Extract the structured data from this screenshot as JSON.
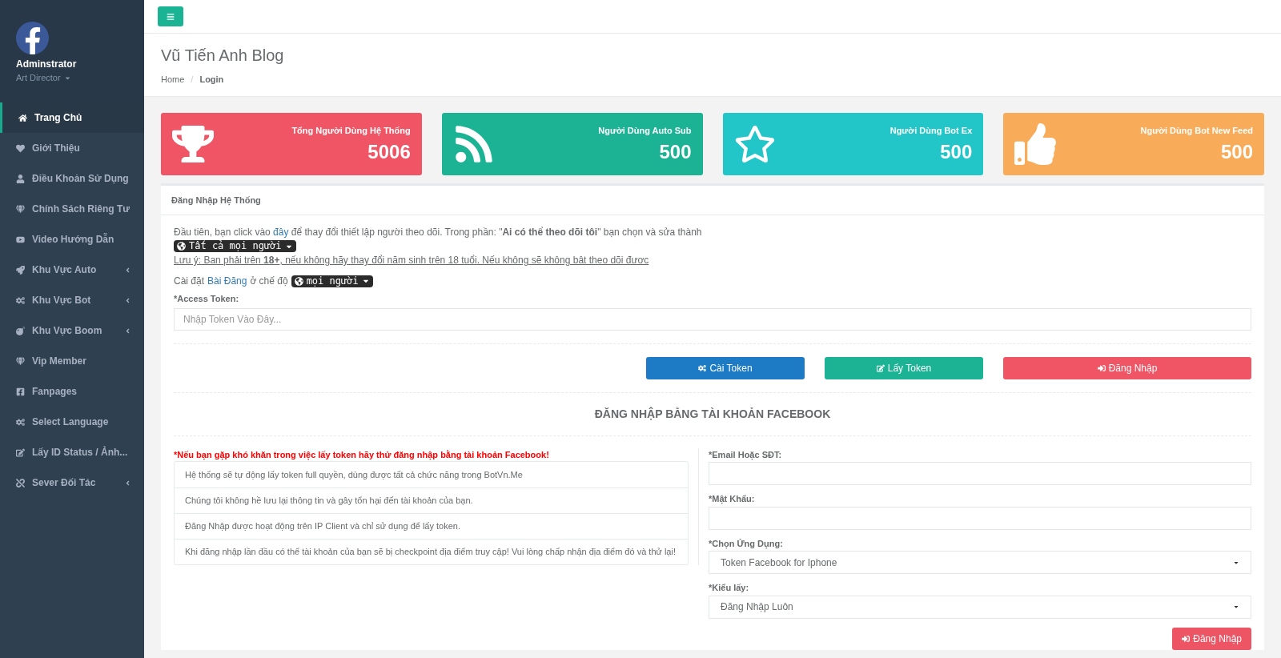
{
  "profile": {
    "name": "Adminstrator",
    "role": "Art Director"
  },
  "sidebar": {
    "items": [
      {
        "label": "Trang Chủ",
        "selected": true,
        "has_submenu": false
      },
      {
        "label": "Giới Thiệu",
        "selected": false,
        "has_submenu": false
      },
      {
        "label": "Điều Khoản Sử Dụng",
        "selected": false,
        "has_submenu": false
      },
      {
        "label": "Chính Sách Riêng Tư",
        "selected": false,
        "has_submenu": false
      },
      {
        "label": "Video Hướng Dẫn",
        "selected": false,
        "has_submenu": false
      },
      {
        "label": "Khu Vực Auto",
        "selected": false,
        "has_submenu": true
      },
      {
        "label": "Khu Vực Bot",
        "selected": false,
        "has_submenu": true
      },
      {
        "label": "Khu Vực Boom",
        "selected": false,
        "has_submenu": true
      },
      {
        "label": "Vip Member",
        "selected": false,
        "has_submenu": false
      },
      {
        "label": "Fanpages",
        "selected": false,
        "has_submenu": false
      },
      {
        "label": "Select Language",
        "selected": false,
        "has_submenu": false
      },
      {
        "label": "Lấy ID Status / Ảnh...",
        "selected": false,
        "has_submenu": false
      },
      {
        "label": "Sever Đối Tác",
        "selected": false,
        "has_submenu": true
      }
    ]
  },
  "page": {
    "title": "Vũ Tiến Anh Blog",
    "breadcrumb": [
      "Home",
      "Login"
    ],
    "breadcrumb_separator": "/"
  },
  "stats": [
    {
      "label": "Tổng Người Dùng Hệ Thống",
      "value": "5006",
      "color": "#ef5565"
    },
    {
      "label": "Người Dùng Auto Sub",
      "value": "500",
      "color": "#1bb394"
    },
    {
      "label": "Người Dùng Bot Ex",
      "value": "500",
      "color": "#23c6c8"
    },
    {
      "label": "Người Dùng Bot New Feed",
      "value": "500",
      "color": "#f8ac59"
    }
  ],
  "login_panel": {
    "title": "Đăng Nhập Hệ Thống",
    "intro_before": "Đầu tiên, bạn click vào",
    "intro_link": "đây",
    "intro_after": "để thay đổi thiết lập người theo dõi. Trong phần: \"**Ai có thể theo dõi tôi**\" bạn chọn và sửa thành",
    "audience_badge": "Tất cả mọi người",
    "note": "Lưu ý: Ban phải trên **18+**, nếu không hãy thay đổi năm sinh trên 18 tuổi. Nếu không sẽ không bât theo dõi đươc",
    "post_before": "Cài đặt",
    "post_link": "Bài Đăng",
    "post_after": "ở chế độ",
    "post_badge": "mọi người",
    "token_label": "*Access Token:",
    "token_placeholder": "Nhập Token Vào Đây...",
    "buttons": [
      {
        "label": "Cài Token",
        "color": "#1d7bc6"
      },
      {
        "label": "Lấy Token",
        "color": "#1bb394"
      },
      {
        "label": "Đăng Nhập",
        "color": "#ef5565"
      }
    ],
    "facebook_heading": "ĐĂNG NHẬP BẰNG TÀI KHOẢN FACEBOOK",
    "warning": "*Nếu bạn gặp khó khăn trong việc lấy token hãy thử đăng nhập bằng tài khoản Facebook!",
    "info_list": [
      "Hệ thống sẽ tự động lấy token full quyền, dùng được tất cả chức năng trong BotVn.Me",
      "Chúng tôi không hề lưu lại thông tin và gây tổn hại đến tài khoản của bạn.",
      "Đăng Nhập được hoạt động trên IP Client và chỉ sử dụng để lấy token.",
      "Khi đăng nhập lần đầu có thể tài khoản của bạn sẽ bị checkpoint địa điểm truy cập! Vui lòng chấp nhận địa điểm đó và thử lại!"
    ],
    "fields": [
      {
        "kind": "input",
        "label": "*Email Hoặc SĐT:"
      },
      {
        "kind": "input",
        "label": "*Mật Khẩu:"
      },
      {
        "kind": "select",
        "label": "*Chọn Ứng Dụng:",
        "value": "Token Facebook for Iphone"
      },
      {
        "kind": "select",
        "label": "*Kiểu lấy:",
        "value": "Đăng Nhập Luôn"
      }
    ],
    "submit": "Đăng Nhập"
  }
}
